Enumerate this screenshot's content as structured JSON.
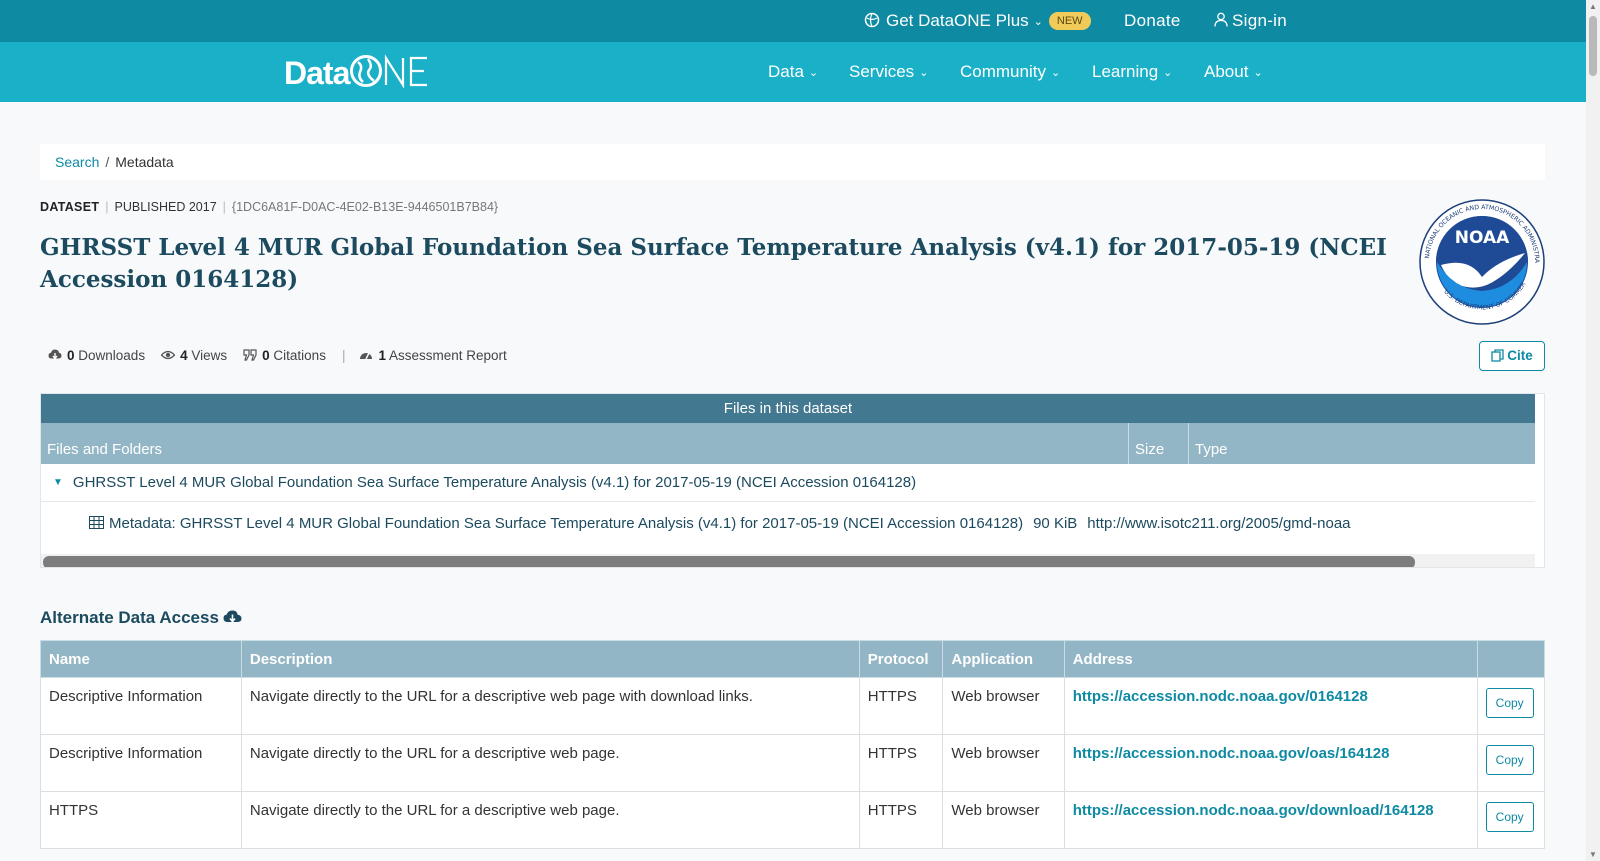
{
  "topbar": {
    "plus_label": "Get DataONE Plus",
    "new_badge": "NEW",
    "donate": "Donate",
    "signin": "Sign-in"
  },
  "brand": {
    "logo_text": "Data"
  },
  "nav": {
    "items": [
      "Data",
      "Services",
      "Community",
      "Learning",
      "About"
    ]
  },
  "breadcrumb": {
    "search": "Search",
    "separator": "/",
    "current": "Metadata"
  },
  "dataset": {
    "type": "DATASET",
    "published": "PUBLISHED 2017",
    "identifier": "{1DC6A81F-D0AC-4E02-B13E-9446501B7B84}",
    "title": "GHRSST Level 4 MUR Global Foundation Sea Surface Temperature Analysis (v4.1) for 2017-05-19 (NCEI Accession 0164128)"
  },
  "stats": {
    "downloads_count": "0",
    "downloads_label": "Downloads",
    "views_count": "4",
    "views_label": "Views",
    "citations_count": "0",
    "citations_label": "Citations",
    "assessment_count": "1",
    "assessment_label": "Assessment Report"
  },
  "cite_label": "Cite",
  "files": {
    "header": "Files in this dataset",
    "columns": [
      "Files and Folders",
      "Size",
      "Type"
    ],
    "folder": "GHRSST Level 4 MUR Global Foundation Sea Surface Temperature Analysis (v4.1) for 2017-05-19 (NCEI Accession 0164128)",
    "file": {
      "name": "Metadata: GHRSST Level 4 MUR Global Foundation Sea Surface Temperature Analysis (v4.1) for 2017-05-19 (NCEI Accession 0164128)",
      "size": "90 KiB",
      "type": "http://www.isotc211.org/2005/gmd-noaa"
    }
  },
  "alternate": {
    "heading": "Alternate Data Access",
    "columns": [
      "Name",
      "Description",
      "Protocol",
      "Application",
      "Address",
      ""
    ],
    "rows": [
      {
        "name": "Descriptive Information",
        "description": "Navigate directly to the URL for a descriptive web page with download links.",
        "protocol": "HTTPS",
        "application": "Web browser",
        "address": "https://accession.nodc.noaa.gov/0164128",
        "copy": "Copy"
      },
      {
        "name": "Descriptive Information",
        "description": "Navigate directly to the URL for a descriptive web page.",
        "protocol": "HTTPS",
        "application": "Web browser",
        "address": "https://accession.nodc.noaa.gov/oas/164128",
        "copy": "Copy"
      },
      {
        "name": "HTTPS",
        "description": "Navigate directly to the URL for a descriptive web page.",
        "protocol": "HTTPS",
        "application": "Web browser",
        "address": "https://accession.nodc.noaa.gov/download/164128",
        "copy": "Copy"
      }
    ]
  },
  "colors": {
    "topbar": "#0e8aa3",
    "navbar": "#1ab0c8",
    "table_header": "#427890",
    "column_header": "#93b6c6",
    "title": "#1c4a5e",
    "badge": "#f1cb5a"
  },
  "icons": [
    "globe-icon",
    "user-icon",
    "cloud-download-icon",
    "eye-icon",
    "quote-icon",
    "gauge-icon",
    "copy-icon",
    "caret-down-icon",
    "table-icon",
    "noaa-logo"
  ],
  "noaa_logo": {
    "name": "NOAA",
    "ring_text": "NATIONAL OCEANIC AND ATMOSPHERIC ADMINISTRATION",
    "bottom_text": "U.S. DEPARTMENT OF COMMERCE"
  }
}
